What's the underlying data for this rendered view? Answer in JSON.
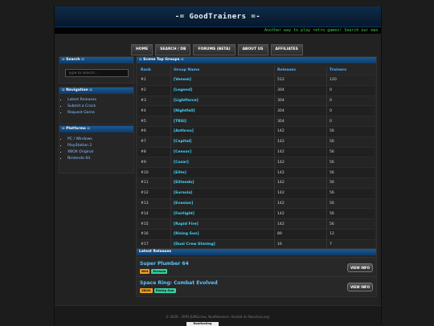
{
  "site": {
    "logo": "-= GoodTrainers =-",
    "ticker": "Another way to play retro games! Search our mas"
  },
  "nav": [
    "HOME",
    "SEARCH / DB",
    "FORUMS (BETA)",
    "ABOUT US",
    "AFFILIATES"
  ],
  "search": {
    "title": ":: Search ::",
    "placeholder": "Type to search..."
  },
  "navigation": {
    "title": ":: Navigation ::",
    "items": [
      "Latest Releases",
      "Submit a Crack",
      "Request Game"
    ]
  },
  "platforms": {
    "title": ":: Platforms ::",
    "items": [
      "PC / Windows",
      "PlayStation 2",
      "XBOX Original",
      "Nintendo 64"
    ]
  },
  "groups": {
    "title": ":: Scene Top Groups ::",
    "headers": [
      "Rank",
      "Group Name",
      "Releases",
      "Trainers"
    ],
    "rows": [
      [
        "#1",
        "[Venom]",
        "512",
        "120"
      ],
      [
        "#2",
        "[Legend]",
        "304",
        "0"
      ],
      [
        "#3",
        "[Lightforce]",
        "304",
        "0"
      ],
      [
        "#4",
        "[Nightfall]",
        "304",
        "0"
      ],
      [
        "#5",
        "[TRSI]",
        "304",
        "0"
      ],
      [
        "#6",
        "[Anthrox]",
        "142",
        "56"
      ],
      [
        "#7",
        "[Capital]",
        "142",
        "56"
      ],
      [
        "#8",
        "[Censor]",
        "142",
        "56"
      ],
      [
        "#9",
        "[Cozar]",
        "142",
        "56"
      ],
      [
        "#10",
        "[Elite]",
        "142",
        "56"
      ],
      [
        "#11",
        "[Elitendo]",
        "142",
        "56"
      ],
      [
        "#12",
        "[Eurasia]",
        "142",
        "56"
      ],
      [
        "#13",
        "[Evasion]",
        "142",
        "56"
      ],
      [
        "#14",
        "[Fairlight]",
        "142",
        "56"
      ],
      [
        "#15",
        "[Rapid Fire]",
        "142",
        "56"
      ],
      [
        "#16",
        "[Rising Sun]",
        "89",
        "12"
      ],
      [
        "#17",
        "[Dual Crew Shining]",
        "16",
        "7"
      ]
    ]
  },
  "latest": {
    "title": "Latest Releases",
    "items": [
      {
        "title": "Super Plumber 64",
        "badges": [
          {
            "text": "N64",
            "color": "#f0a020"
          },
          {
            "text": "Eurasia",
            "color": "#38d0a0"
          }
        ],
        "button": "VIEW INFO"
      },
      {
        "title": "Space Ring: Combat Evolved",
        "badges": [
          {
            "text": "XBOX",
            "color": "#f0a020"
          },
          {
            "text": "Rising Sun",
            "color": "#38d0a0"
          }
        ],
        "button": "VIEW INFO"
      }
    ]
  },
  "footer": {
    "copyright": "© 2026 - 2093 JUNGcrew, NooReleases. Hosted on Nooclass.org.",
    "host_logo": "NooHosting"
  }
}
